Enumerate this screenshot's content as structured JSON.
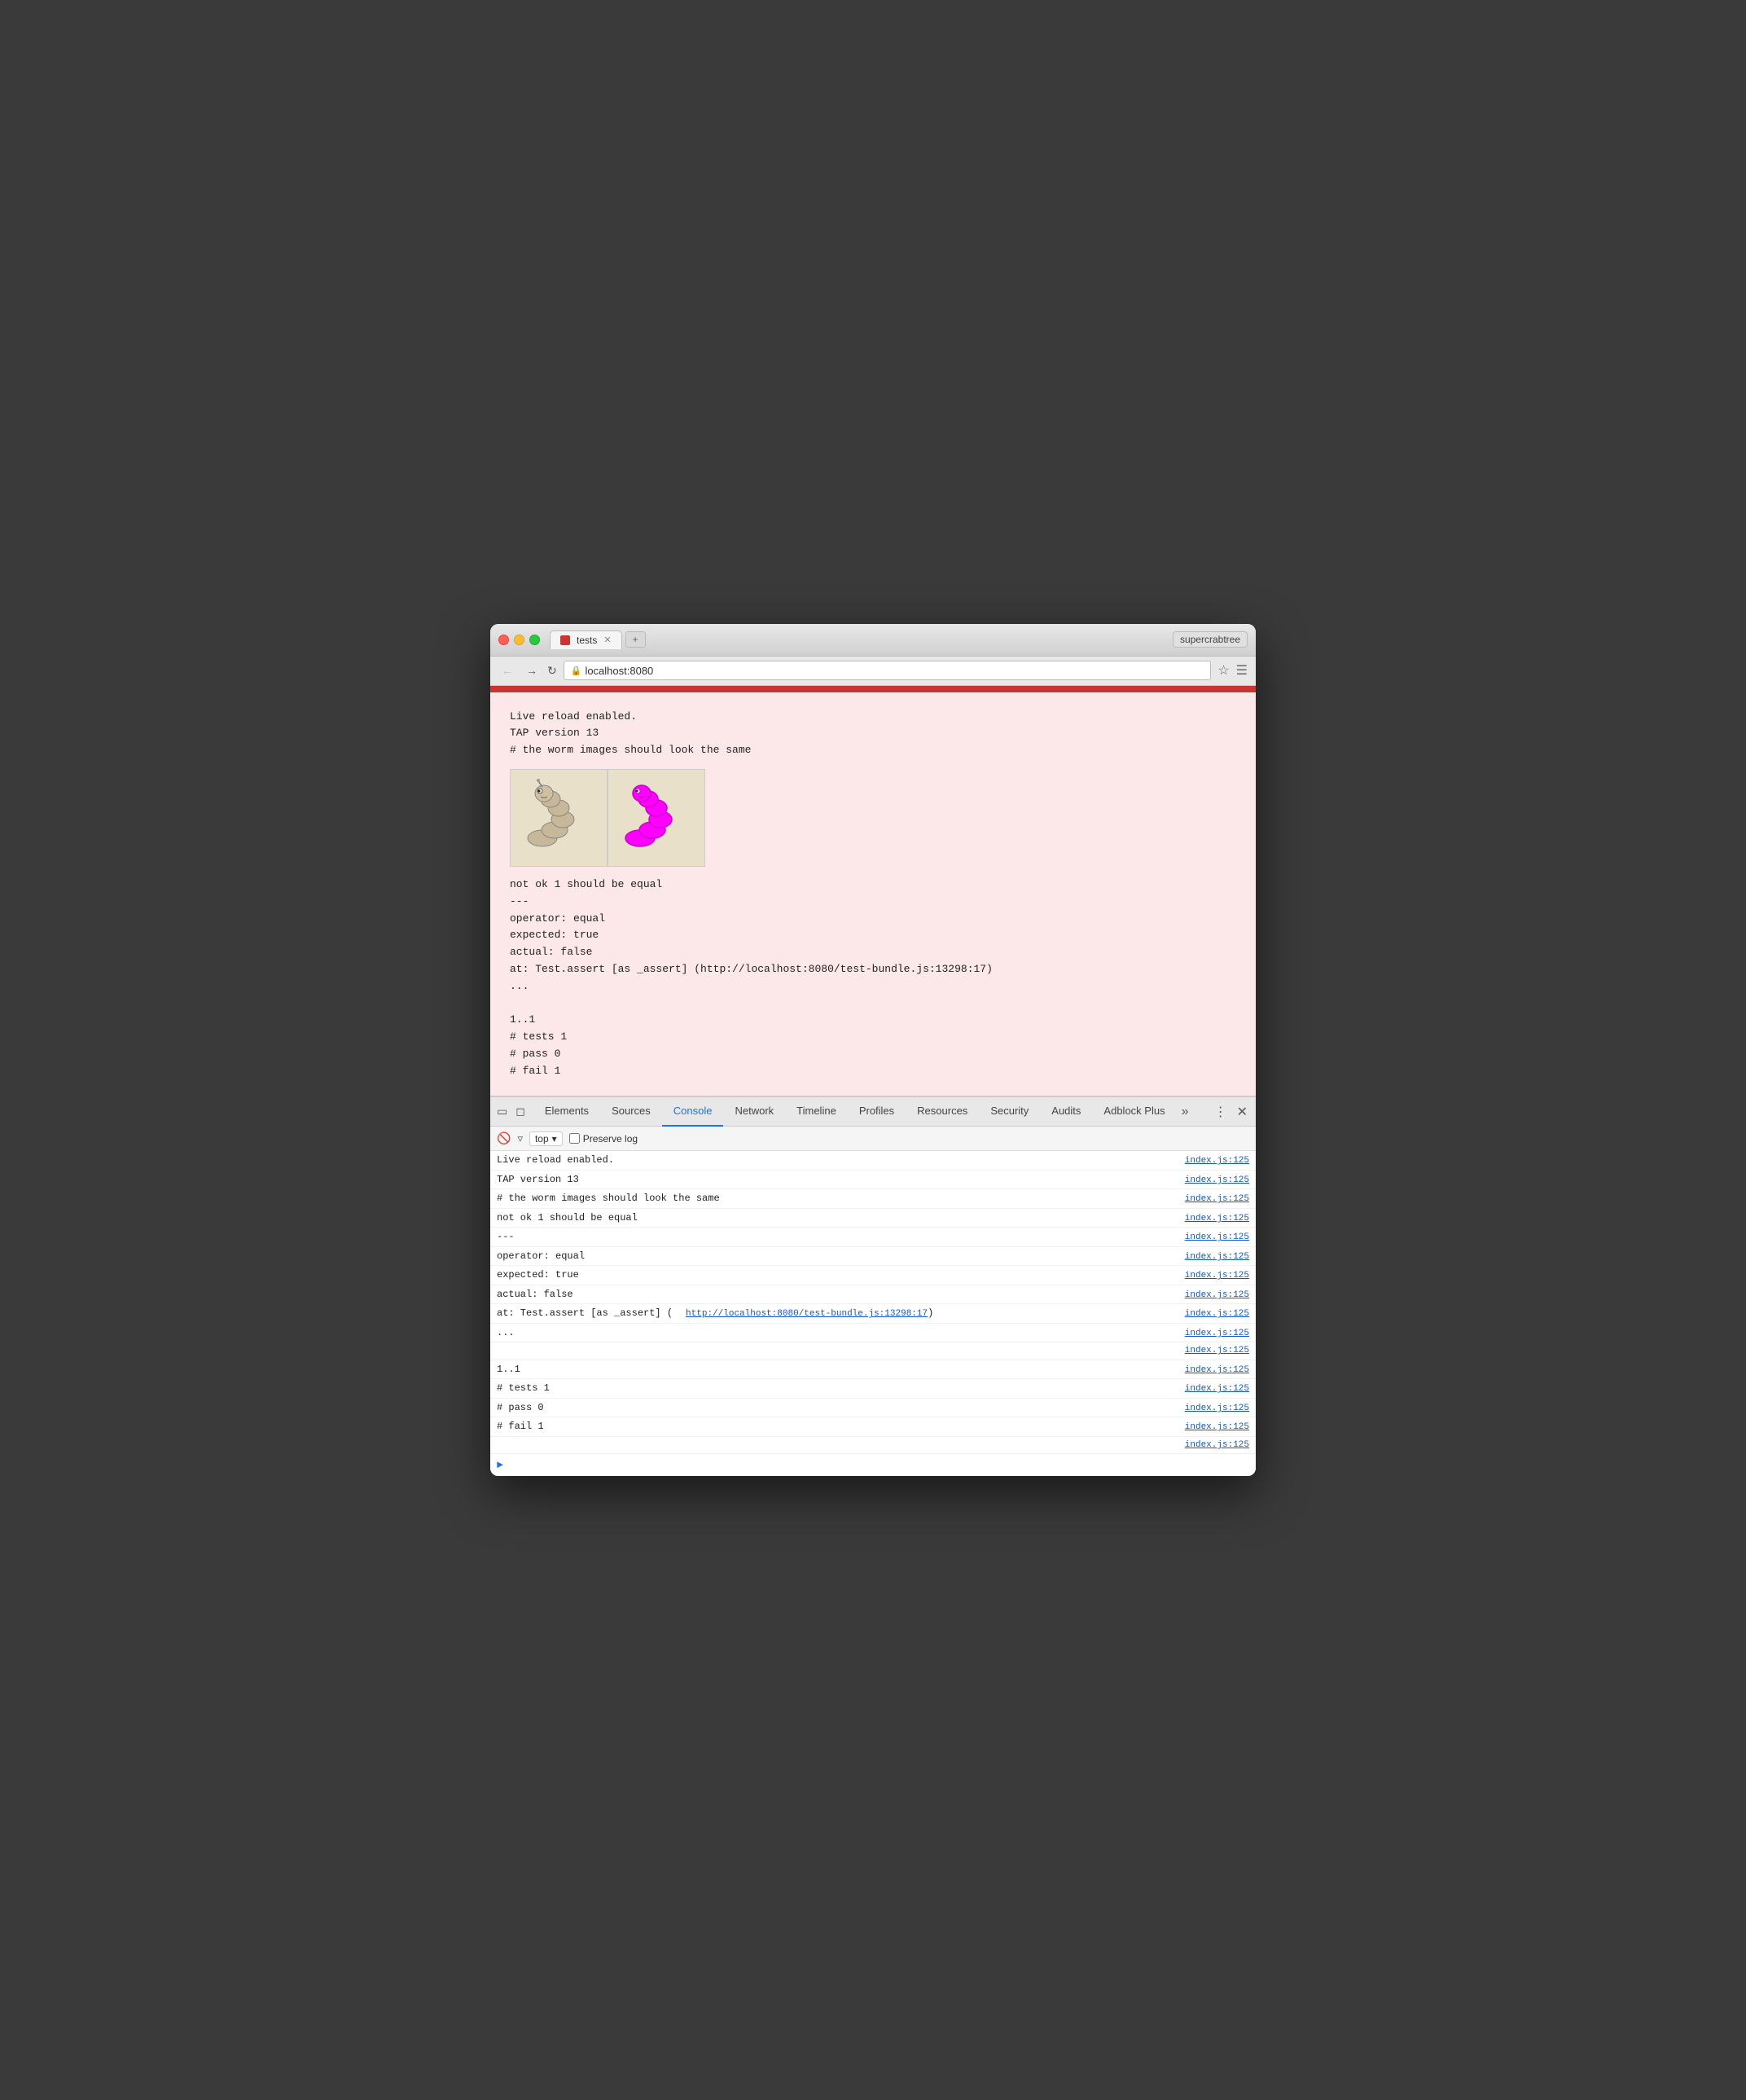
{
  "browser": {
    "title": "tests",
    "url": "localhost:8080",
    "profile": "supercrabtree",
    "new_tab_label": "+"
  },
  "devtools": {
    "tabs": [
      {
        "id": "elements",
        "label": "Elements"
      },
      {
        "id": "sources",
        "label": "Sources"
      },
      {
        "id": "console",
        "label": "Console",
        "active": true
      },
      {
        "id": "network",
        "label": "Network"
      },
      {
        "id": "timeline",
        "label": "Timeline"
      },
      {
        "id": "profiles",
        "label": "Profiles"
      },
      {
        "id": "resources",
        "label": "Resources"
      },
      {
        "id": "security",
        "label": "Security"
      },
      {
        "id": "audits",
        "label": "Audits"
      },
      {
        "id": "adblock-plus",
        "label": "Adblock Plus"
      }
    ],
    "console_context": "top",
    "preserve_log_label": "Preserve log"
  },
  "page_output": {
    "lines": [
      "Live reload enabled.",
      "TAP version 13",
      "# the worm images should look the same",
      "",
      "not ok 1 should be equal",
      "  ---",
      "    operator: equal",
      "    expected: true",
      "    actual:   false",
      "    at: Test.assert [as _assert] (http://localhost:8080/test-bundle.js:13298:17)",
      "  ...",
      "",
      "1..1",
      "# tests 1",
      "# pass  0",
      "# fail  1"
    ]
  },
  "console_output": {
    "lines": [
      {
        "text": "Live reload enabled.",
        "link": "index.js:125"
      },
      {
        "text": "TAP version 13",
        "link": "index.js:125"
      },
      {
        "text": "# the worm images should look the same",
        "link": "index.js:125"
      },
      {
        "text": "not ok 1 should be equal",
        "link": "index.js:125"
      },
      {
        "text": "  ---",
        "link": "index.js:125"
      },
      {
        "text": "    operator: equal",
        "link": "index.js:125"
      },
      {
        "text": "    expected: true",
        "link": "index.js:125"
      },
      {
        "text": "    actual:   false",
        "link": "index.js:125"
      },
      {
        "text": "    at: Test.assert [as _assert] (http://localhost:8080/test-bundle.js:13298:17)",
        "link": "index.js:125",
        "has_link": true,
        "link_text": "http://localhost:8080/test-bundle.js:13298:17"
      },
      {
        "text": "  ...",
        "link": "index.js:125"
      },
      {
        "text": "",
        "link": "index.js:125"
      },
      {
        "text": "1..1",
        "link": "index.js:125"
      },
      {
        "text": "# tests 1",
        "link": "index.js:125"
      },
      {
        "text": "# pass  0",
        "link": "index.js:125"
      },
      {
        "text": "# fail  1",
        "link": "index.js:125"
      },
      {
        "text": "",
        "link": "index.js:125"
      }
    ]
  }
}
